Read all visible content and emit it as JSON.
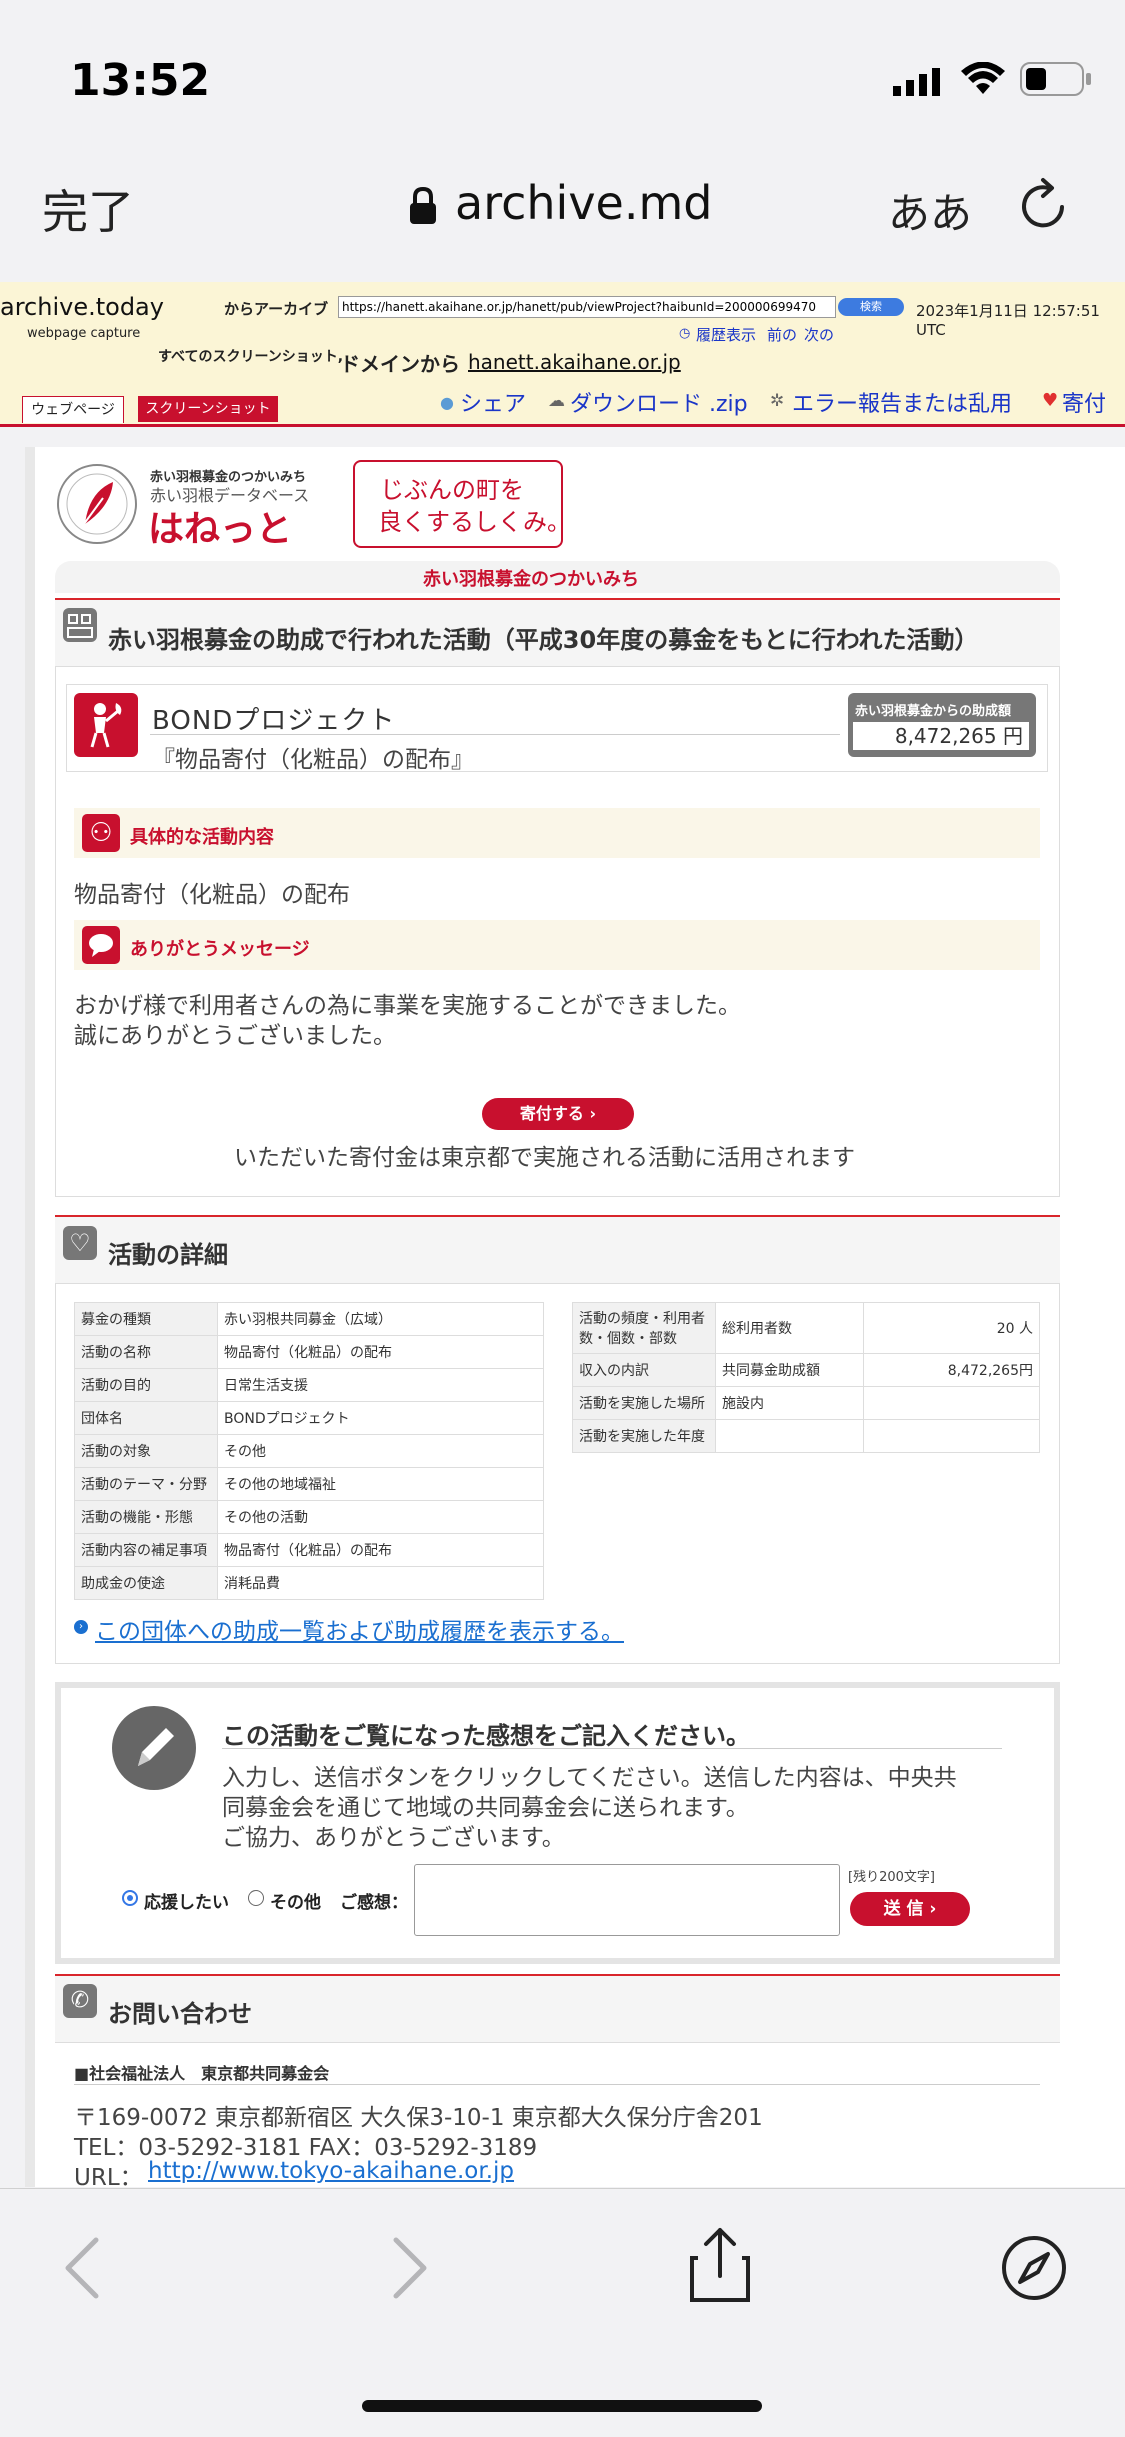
{
  "status_bar": {
    "time": "13:52"
  },
  "safari": {
    "done_label": "完了",
    "host": "archive.md",
    "aa_label": "ああ"
  },
  "archive": {
    "logo": "archive.today",
    "logo_sub": "webpage capture",
    "from_archive_label": "からアーカイブ",
    "url_value": "https://hanett.akaihane.or.jp/hanett/pub/viewProject?haibunId=200000699470",
    "search_label": "検索",
    "timestamp": "2023年1月11日 12:57:51 UTC",
    "history_label": "履歴表示",
    "prev_label": "前の",
    "next_label": "次の",
    "all_screenshots_label": "すべてのスクリーンショット,",
    "from_domain_label": "ドメインから",
    "domain_link": "hanett.akaihane.or.jp",
    "tab_webpage": "ウェブページ",
    "tab_screenshot": "スクリーンショット",
    "share": "シェア",
    "download": "ダウンロード .zip",
    "report": "エラー報告または乱用",
    "donate": "寄付"
  },
  "page": {
    "logo_top": "赤い羽根募金のつかいみち",
    "logo_db": "赤い羽根データベース",
    "logo_main": "はねっと",
    "slogan_1": "じぶんの町を",
    "slogan_2": "良くするしくみ。",
    "tagline": "赤い羽根募金のつかいみち",
    "section1_title": "赤い羽根募金の助成で行われた活動（平成30年度の募金をもとに行われた活動）",
    "project_name": "BONDプロジェクト",
    "project_sub": "『物品寄付（化粧品）の配布』",
    "grant_label": "赤い羽根募金からの助成額",
    "grant_amount": "8,472,265 円",
    "activity_head": "具体的な活動内容",
    "activity_text": "物品寄付（化粧品）の配布",
    "thanks_head": "ありがとうメッセージ",
    "thanks_line1": "おかげ様で利用者さんの為に事業を実施することができました。",
    "thanks_line2": "誠にありがとうございました。",
    "donate_btn": "寄付する ›",
    "donate_note": "いただいた寄付金は東京都で実施される活動に活用されます",
    "details_title": "活動の詳細",
    "details_left": [
      {
        "k": "募金の種類",
        "v": "赤い羽根共同募金（広域）"
      },
      {
        "k": "活動の名称",
        "v": "物品寄付（化粧品）の配布"
      },
      {
        "k": "活動の目的",
        "v": "日常生活支援"
      },
      {
        "k": "団体名",
        "v": "BONDプロジェクト"
      },
      {
        "k": "活動の対象",
        "v": "その他"
      },
      {
        "k": "活動のテーマ・分野",
        "v": "その他の地域福祉"
      },
      {
        "k": "活動の機能・形態",
        "v": "その他の活動"
      },
      {
        "k": "活動内容の補足事項",
        "v": "物品寄付（化粧品）の配布"
      },
      {
        "k": "助成金の使途",
        "v": "消耗品費"
      }
    ],
    "details_right": [
      {
        "k": "活動の頻度・利用者数・個数・部数",
        "v1": "総利用者数",
        "v2": "20 人"
      },
      {
        "k": "収入の内訳",
        "v1": "共同募金助成額",
        "v2": "8,472,265円"
      },
      {
        "k": "活動を実施した場所",
        "v1": "施設内",
        "v2": ""
      },
      {
        "k": "活動を実施した年度",
        "v1": "",
        "v2": ""
      }
    ],
    "history_link": "この団体への助成一覧および助成履歴を表示する。",
    "feedback_title": "この活動をご覧になった感想をご記入ください。",
    "feedback_line1": "入力し、送信ボタンをクリックしてください。送信した内容は、中央共",
    "feedback_line2": "同募金会を通じて地域の共同募金会に送られます。",
    "feedback_line3": "ご協力、ありがとうございます。",
    "radio_support": "応援したい",
    "radio_other": "その他",
    "impression_label": "ご感想：",
    "remaining": "[残り200文字]",
    "send_btn": "送 信 ›",
    "contact_title": "お問い合わせ",
    "org_name": "■社会福祉法人　東京都共同募金会",
    "address": "〒169-0072 東京都新宿区 大久保3-10-1 東京都大久保分庁舎201",
    "tel": "TEL：03-5292-3181 FAX：03-5292-3189",
    "url_label": "URL：",
    "url_link": "http://www.tokyo-akaihane.or.jp"
  }
}
